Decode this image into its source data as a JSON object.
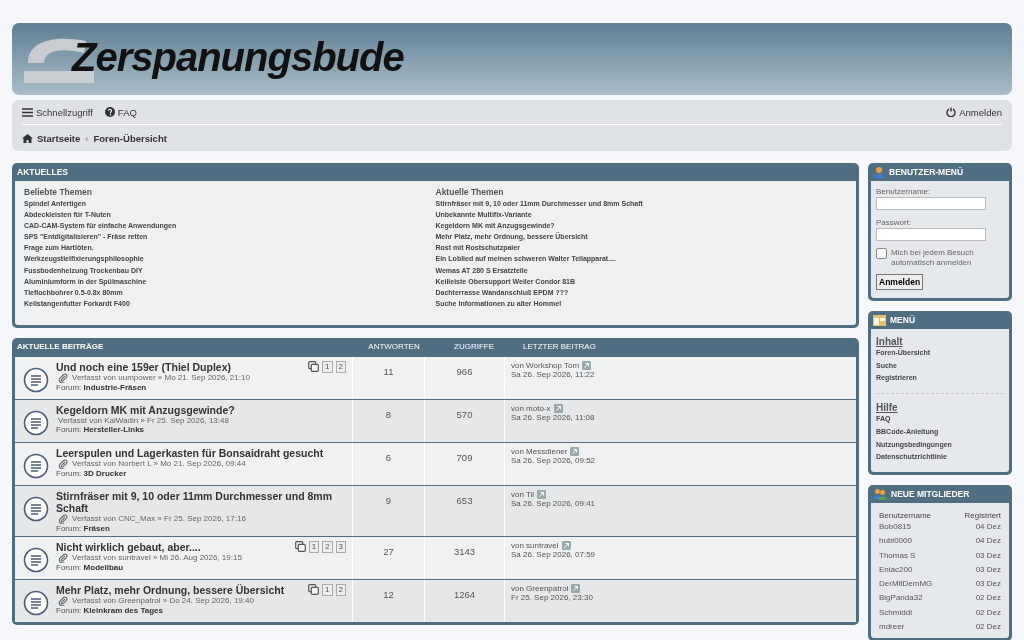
{
  "header": {
    "logo_text": "Zerspanungsbude"
  },
  "navbar": {
    "quick_access": "Schnellzugriff",
    "faq": "FAQ",
    "login": "Anmelden"
  },
  "breadcrumbs": [
    {
      "label": "Startseite",
      "home": true
    },
    {
      "separator": "‹",
      "label": "Foren-Übersicht",
      "home": false
    }
  ],
  "news": {
    "title": "AKTUELLES",
    "columns": [
      {
        "heading": "Beliebte Themen",
        "items": [
          "Spindel Anfertigen",
          "Abdeckleisten für T-Nuten",
          "CAD-CAM-System für einfache Anwendungen",
          "SPS \"Entdigitalisieren\" - Fräse retten",
          "Frage zum Hartlöten.",
          "Werkzeugstielfixierungsphilosophie",
          "Fussbodenheizung Trockenbau DIY",
          "Aluminiumform in der Spülmaschine",
          "Tieflochbohrer 0.5-0.8x 80mm",
          "Keilstangenfutter Forkardt F400"
        ]
      },
      {
        "heading": "Aktuelle Themen",
        "items": [
          "Stirnfräser mit 9, 10 oder 11mm Durchmesser und 8mm Schaft",
          "Unbekannte Multifix-Variante",
          "Kegeldorn MK mit Anzugsgewinde?",
          "Mehr Platz, mehr Ordnung, bessere Übersicht",
          "Rost mit Rostschutzpaier",
          "Ein Loblied auf meinen schweren Walter Teilapparat....",
          "Wemas AT 280 S Ersatzteile",
          "Keilleiste Obersupport Weiler Condor 81B",
          "Dachterrasse Wandanschluß EPDM ???",
          "Suche Informationen zu alter Hommel"
        ]
      }
    ]
  },
  "posts": {
    "columns": [
      "AKTUELLE BEITRÄGE",
      "ANTWORTEN",
      "ZUGRIFFE",
      "LETZTER BEITRAG"
    ],
    "rows": [
      {
        "title": "Und noch eine 159er (Thiel Duplex)",
        "attachment": true,
        "byline": "Verfasst von uumpower » Mo 21. Sep 2026, 21:10",
        "forum_label": "Forum:",
        "forum": "Industrie-Fräsen",
        "pages": [
          "1",
          "2"
        ],
        "replies": "11",
        "views": "966",
        "last_by": "von Workshop Tom",
        "last_date": "Sa 26. Sep 2026, 11:22"
      },
      {
        "title": "Kegeldorn MK mit Anzugsgewinde?",
        "attachment": false,
        "byline": "Verfasst von KalWadin » Fr 25. Sep 2026, 13:48",
        "forum_label": "Forum:",
        "forum": "Hersteller-Links",
        "pages": [],
        "replies": "8",
        "views": "570",
        "last_by": "von moto-x",
        "last_date": "Sa 26. Sep 2026, 11:08"
      },
      {
        "title": "Leerspulen und Lagerkasten für Bonsaidraht gesucht",
        "attachment": true,
        "byline": "Verfasst von Norbert L » Mo 21. Sep 2026, 09:44",
        "forum_label": "Forum:",
        "forum": "3D Drucker",
        "pages": [],
        "replies": "6",
        "views": "709",
        "last_by": "von Messdiener",
        "last_date": "Sa 26. Sep 2026, 09:52"
      },
      {
        "title": "Stirnfräser mit 9, 10 oder 11mm Durchmesser und 8mm Schaft",
        "attachment": true,
        "byline": "Verfasst von CNC_Max » Fr 25. Sep 2026, 17:16",
        "forum_label": "Forum:",
        "forum": "Fräsen",
        "pages": [],
        "replies": "9",
        "views": "653",
        "last_by": "von Til",
        "last_date": "Sa 26. Sep 2026, 09:41"
      },
      {
        "title": "Nicht wirklich gebaut, aber....",
        "attachment": true,
        "byline": "Verfasst von suntravel » Mi 26. Aug 2026, 19:15",
        "forum_label": "Forum:",
        "forum": "Modellbau",
        "pages": [
          "1",
          "2",
          "3"
        ],
        "replies": "27",
        "views": "3143",
        "last_by": "von suntravel",
        "last_date": "Sa 26. Sep 2026, 07:59"
      },
      {
        "title": "Mehr Platz, mehr Ordnung, bessere Übersicht",
        "attachment": true,
        "byline": "Verfasst von Greenpatrol » Do 24. Sep 2026, 19:40",
        "forum_label": "Forum:",
        "forum": "Kleinkram des Tages",
        "pages": [
          "1",
          "2"
        ],
        "replies": "12",
        "views": "1264",
        "last_by": "von Greenpatrol",
        "last_date": "Fr 25. Sep 2026, 23:30"
      }
    ]
  },
  "user_menu": {
    "title": "BENUTZER-MENÜ",
    "username_label": "Benutzername:",
    "password_label": "Passwort:",
    "remember": {
      "label": "Mich bei jedem Besuch automatisch anmelden",
      "checked": false
    },
    "button": "Anmelden"
  },
  "menu": {
    "title": "MENÜ",
    "sections": [
      {
        "heading": "Inhalt",
        "items": [
          "Foren-Übersicht",
          "Suche",
          "Registrieren"
        ]
      },
      {
        "heading": "Hilfe",
        "items": [
          "FAQ",
          "BBCode-Anleitung",
          "Nutzungsbedingungen",
          "Datenschutzrichtlinie"
        ]
      }
    ]
  },
  "new_members": {
    "title": "NEUE MITGLIEDER",
    "columns": [
      "Benutzername",
      "Registriert"
    ],
    "rows": [
      [
        "Bob0815",
        "04 Dez"
      ],
      [
        "hubi0000",
        "04 Dez"
      ],
      [
        "Thomas S",
        "03 Dez"
      ],
      [
        "Eniac200",
        "03 Dez"
      ],
      [
        "DerMitDemMG",
        "03 Dez"
      ],
      [
        "BigPanda32",
        "02 Dez"
      ],
      [
        "Schmiddi",
        "02 Dez"
      ],
      [
        "mdreer",
        "02 Dez"
      ]
    ]
  }
}
